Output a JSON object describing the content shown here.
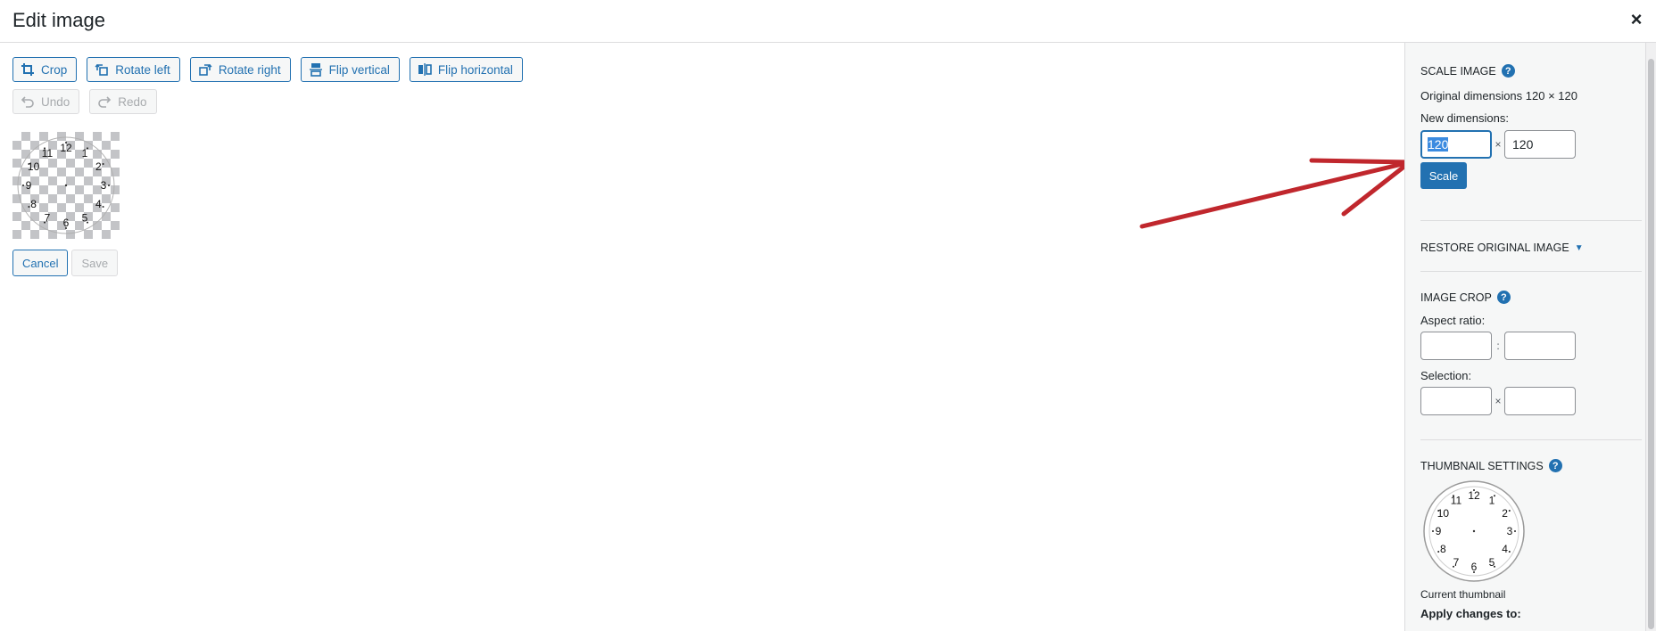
{
  "header": {
    "title": "Edit image",
    "close_glyph": "×"
  },
  "toolbar": {
    "crop": "Crop",
    "rotate_left": "Rotate left",
    "rotate_right": "Rotate right",
    "flip_vertical": "Flip vertical",
    "flip_horizontal": "Flip horizontal",
    "undo": "Undo",
    "redo": "Redo"
  },
  "preview": {
    "clock_numbers": [
      "12",
      "1",
      "2",
      "3",
      "4",
      "5",
      "6",
      "7",
      "8",
      "9",
      "10",
      "11"
    ]
  },
  "actions": {
    "cancel": "Cancel",
    "save": "Save"
  },
  "sidebar": {
    "scale_image": {
      "title": "Scale Image",
      "original_dimensions": "Original dimensions 120 × 120",
      "new_dimensions_label": "New dimensions:",
      "width_value": "120",
      "height_value": "120",
      "times": "×",
      "scale_button": "Scale"
    },
    "restore": {
      "title": "Restore original image",
      "caret": "▼"
    },
    "image_crop": {
      "title": "Image Crop",
      "aspect_ratio_label": "Aspect ratio:",
      "ratio_separator": ":",
      "selection_label": "Selection:",
      "selection_separator": "×"
    },
    "thumbnail": {
      "title": "Thumbnail Settings",
      "current_thumbnail": "Current thumbnail",
      "apply_changes_to": "Apply changes to:"
    }
  },
  "colors": {
    "accent": "#2271b1",
    "arrow": "#c0272d",
    "sidebar_bg": "#f6f7f7"
  }
}
